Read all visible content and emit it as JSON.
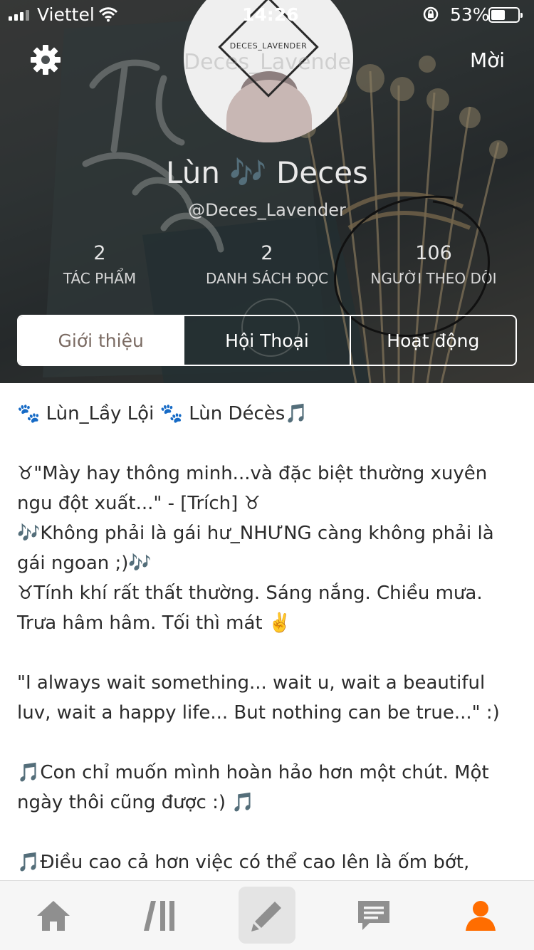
{
  "status_bar": {
    "carrier": "Viettel",
    "time": "14:26",
    "battery_percent": "53%",
    "battery_level": 0.53
  },
  "header": {
    "invite_label": "Mời",
    "avatar_text": "DECES_LAVENDER",
    "avatar_overlay_name": "Deces_Lavender",
    "display_name": "Lùn 🎶 Deces",
    "username": "@Deces_Lavender"
  },
  "stats": [
    {
      "value": "2",
      "label": "TÁC PHẨM"
    },
    {
      "value": "2",
      "label": "DANH SÁCH ĐỌC"
    },
    {
      "value": "106",
      "label": "NGƯỜI THEO DÕI"
    }
  ],
  "tabs": [
    {
      "label": "Giới thiệu",
      "active": true
    },
    {
      "label": "Hội Thoại",
      "active": false
    },
    {
      "label": "Hoạt động",
      "active": false
    }
  ],
  "bio": {
    "lines": [
      "🐾 Lùn_Lầy Lội 🐾 Lùn Décès🎵",
      "",
      "♉\"Mày hay thông minh...và đặc biệt thường xuyên ngu đột xuất...\" - [Trích] ♉",
      "🎶Không phải là gái hư_NHƯNG càng không phải là gái ngoan ;)🎶",
      "♉Tính khí rất thất thường. Sáng nắng. Chiều mưa. Trưa hâm hâm. Tối thì mát ✌️",
      "",
      "\"I always wait something... wait u, wait a beautiful luv, wait a happy life... But nothing can be true...\" :)",
      "",
      "🎵Con chỉ muốn mình hoàn hảo hơn một chút. Một ngày thôi cũng được :) 🎵",
      "",
      "🎵Điều cao cả hơn việc có thể cao lên là ốm bớt,"
    ]
  },
  "bottom_nav": {
    "items": [
      "home-icon",
      "library-icon",
      "write-icon",
      "messages-icon",
      "profile-icon"
    ],
    "active_color": "#ff6d00",
    "inactive_color": "#8f8f8f"
  },
  "colors": {
    "tab_active_text": "#7a6a62",
    "bio_text": "#2b2b2b"
  }
}
